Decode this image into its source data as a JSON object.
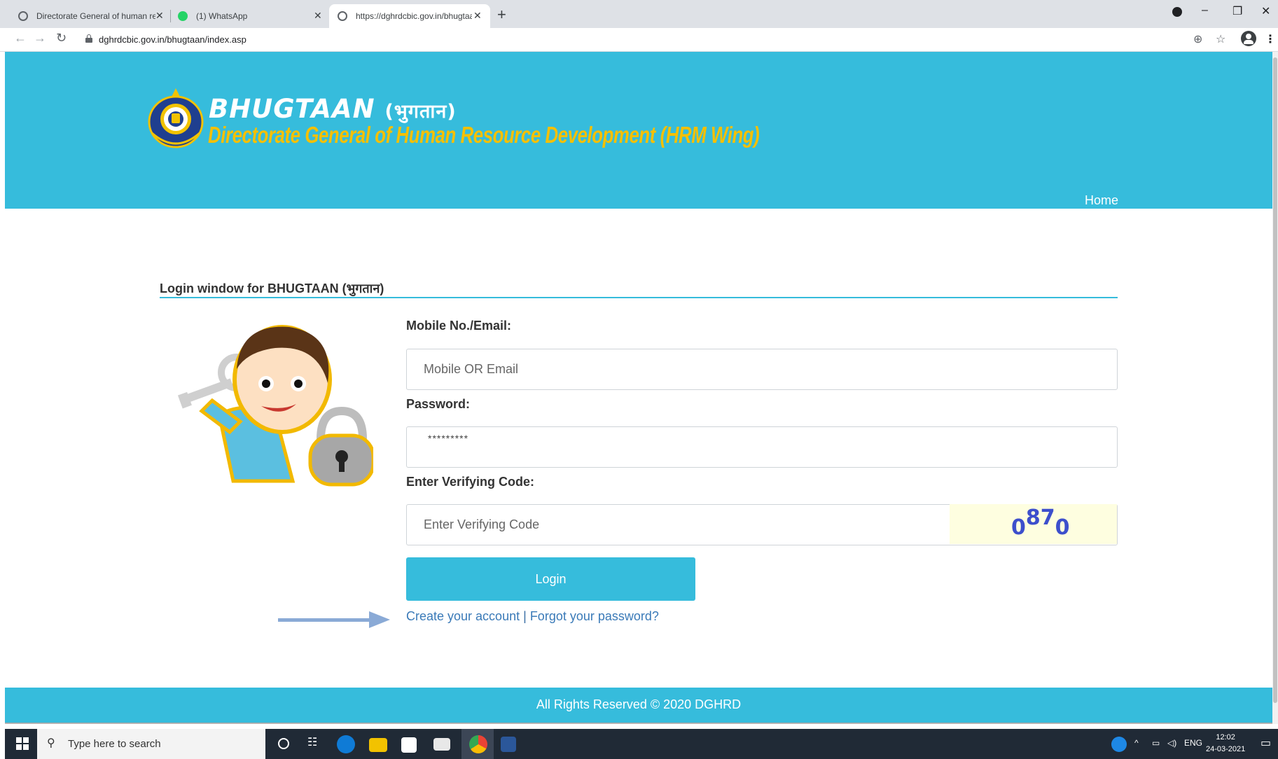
{
  "browser": {
    "tabs": [
      {
        "title": "Directorate General of human re",
        "active": false
      },
      {
        "title": "(1) WhatsApp",
        "active": false
      },
      {
        "title": "https://dghrdcbic.gov.in/bhugtaa",
        "active": true
      }
    ],
    "new_tab_label": "+",
    "url": "dghrdcbic.gov.in/bhugtaan/index.asp"
  },
  "header": {
    "title": "BHUGTAAN",
    "title_hindi": "(भुगतान)",
    "subtitle": "Directorate General of Human Resource Development (HRM Wing)",
    "nav_home": "Home",
    "colors": {
      "banner": "#36bcdc",
      "subtitle": "#f5c000"
    }
  },
  "login": {
    "heading": "Login window for BHUGTAAN (भुगतान)",
    "mobile_label": "Mobile No./Email:",
    "mobile_placeholder": "Mobile OR Email",
    "password_label": "Password:",
    "password_value": "*********",
    "code_label": "Enter Verifying Code:",
    "code_placeholder": "Enter Verifying Code",
    "captcha": [
      "0",
      "87",
      "0"
    ],
    "login_button": "Login",
    "create_account": "Create your account",
    "separator": "|",
    "forgot_password": "Forgot your password?"
  },
  "footer": {
    "text": "All Rights Reserved © 2020 DGHRD"
  },
  "taskbar": {
    "search_placeholder": "Type here to search",
    "tray_language": "ENG",
    "time": "12:02",
    "date": "24-03-2021"
  },
  "icons": [
    "globe-icon",
    "whatsapp-icon",
    "close-icon",
    "back-icon",
    "forward-icon",
    "reload-icon",
    "lock-icon",
    "zoom-icon",
    "star-icon",
    "profile-icon",
    "menu-icon",
    "windows-start-icon",
    "search-icon",
    "cortana-icon",
    "task-view-icon",
    "edge-icon",
    "file-explorer-icon",
    "store-icon",
    "mail-icon",
    "chrome-icon",
    "word-icon",
    "help-icon",
    "notification-icon"
  ]
}
